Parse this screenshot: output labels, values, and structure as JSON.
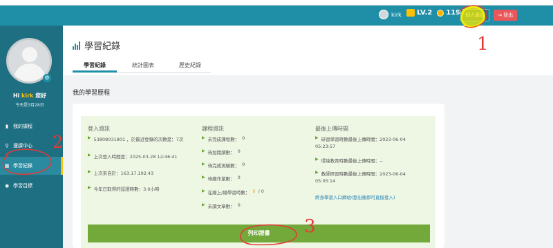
{
  "header": {
    "username": "kirk",
    "level": "LV.2",
    "coins": "119",
    "profile_button": "個人專區",
    "logout_button": "登出"
  },
  "sidebar": {
    "greeting_prefix": "Hi ",
    "greeting_name": "kirk",
    "greeting_suffix": " 您好",
    "date_line": "今天是3月28日",
    "items": [
      {
        "label": "我的課程",
        "icon": "book-icon"
      },
      {
        "label": "搜課中心",
        "icon": "search-icon"
      },
      {
        "label": "學習紀錄",
        "icon": "chart-icon"
      },
      {
        "label": "學習目標",
        "icon": "target-icon"
      }
    ]
  },
  "page": {
    "title": "學習紀錄",
    "tabs": [
      "學習紀錄",
      "統計圖表",
      "歷史紀錄"
    ],
    "section_title": "我的學習歷程"
  },
  "panel": {
    "login": {
      "title": "登入資訊",
      "rows": [
        "53808031801 ，於最近登錄的次數是：7次",
        "上次登入時間是：2025-03-28 12:46:41",
        "上次來自於：163.17.192.43",
        "今年已取得的認證時數：3.0小時"
      ]
    },
    "course": {
      "title": "課程資訊",
      "rows": [
        {
          "label": "未完成課程數：",
          "value": "0"
        },
        {
          "label": "待加閱讀數：",
          "value": "0"
        },
        {
          "label": "待完成測驗數：",
          "value": "0"
        },
        {
          "label": "待繳作業數：",
          "value": "0"
        },
        {
          "label": "在線上/總學習時數：",
          "value": "0 / 0",
          "highlight": "0"
        },
        {
          "label": "未讀文章數：",
          "value": "0"
        }
      ]
    },
    "upload": {
      "title": "最後上傳時間",
      "rows": [
        {
          "label": "研習學習時數最後上傳時間：2023-06-04",
          "time": "05:23:57"
        },
        {
          "label": "環境教育時數最後上傳時間：--",
          "time": ""
        },
        {
          "label": "教師研習時數最後上傳時間：2023-06-04",
          "time": "05:05:14"
        }
      ],
      "link": "終身學習入口網站(登出後即可直接登入)"
    },
    "print_button": "列印證書"
  },
  "annotations": {
    "one": "1",
    "two": "2",
    "three": "3"
  },
  "colors": {
    "topbar": "#1f8fa8",
    "sidebar": "#1f6f83",
    "panel": "#eef6e4",
    "print_button": "#73a83a",
    "annotation_red": "#e53935",
    "annotation_yellow": "#f5e900"
  }
}
